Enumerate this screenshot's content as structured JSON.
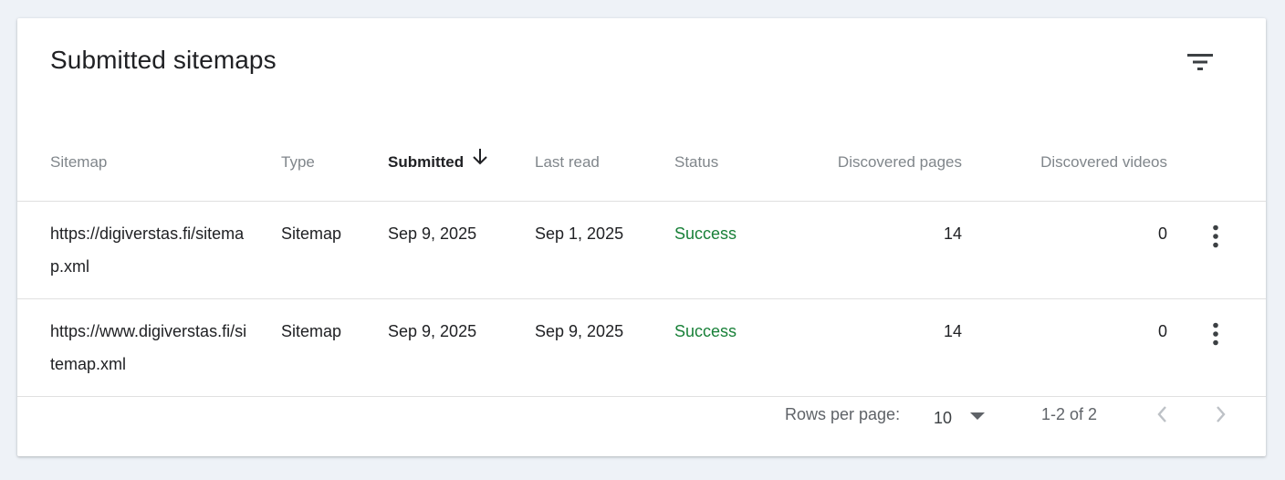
{
  "card": {
    "title": "Submitted sitemaps"
  },
  "icons": {
    "filter": "filter-list-icon",
    "sort": "arrow-downward-icon",
    "more": "more-vert-icon",
    "dropdown": "arrow-drop-down-icon",
    "prev": "chevron-left-icon",
    "next": "chevron-right-icon"
  },
  "colors": {
    "success": "#188038",
    "header_muted": "#80868b",
    "background": "#eef2f7"
  },
  "table": {
    "columns": {
      "sitemap": "Sitemap",
      "type": "Type",
      "submitted": "Submitted",
      "last_read": "Last read",
      "status": "Status",
      "discovered_pages": "Discovered pages",
      "discovered_videos": "Discovered videos"
    },
    "sort_column": "submitted",
    "rows": [
      {
        "sitemap": "https://digiverstas.fi/sitemap.xml",
        "type": "Sitemap",
        "submitted": "Sep 9, 2025",
        "last_read": "Sep 1, 2025",
        "status": "Success",
        "discovered_pages": "14",
        "discovered_videos": "0"
      },
      {
        "sitemap": "https://www.digiverstas.fi/sitemap.xml",
        "type": "Sitemap",
        "submitted": "Sep 9, 2025",
        "last_read": "Sep 9, 2025",
        "status": "Success",
        "discovered_pages": "14",
        "discovered_videos": "0"
      }
    ]
  },
  "pagination": {
    "rows_per_page_label": "Rows per page:",
    "rows_per_page_value": "10",
    "range": "1-2 of 2"
  }
}
